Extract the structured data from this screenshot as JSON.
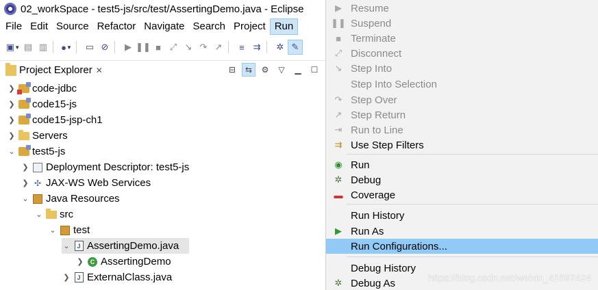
{
  "window": {
    "title": "02_workSpace - test5-js/src/test/AssertingDemo.java - Eclipse"
  },
  "menubar": {
    "items": [
      "File",
      "Edit",
      "Source",
      "Refactor",
      "Navigate",
      "Search",
      "Project",
      "Run"
    ],
    "active": "Run"
  },
  "view": {
    "title": "Project Explorer",
    "close_glyph": "✕"
  },
  "tree": [
    {
      "label": "code-jdbc",
      "level": 0,
      "expanded": false,
      "icon": "project-error-icon"
    },
    {
      "label": "code15-js",
      "level": 0,
      "expanded": false,
      "icon": "project-icon"
    },
    {
      "label": "code15-jsp-ch1",
      "level": 0,
      "expanded": false,
      "icon": "project-icon"
    },
    {
      "label": "Servers",
      "level": 0,
      "expanded": false,
      "icon": "folder-icon"
    },
    {
      "label": "test5-js",
      "level": 0,
      "expanded": true,
      "icon": "project-icon"
    },
    {
      "label": "Deployment Descriptor: test5-js",
      "level": 1,
      "expanded": false,
      "icon": "descriptor-icon"
    },
    {
      "label": "JAX-WS Web Services",
      "level": 1,
      "expanded": false,
      "icon": "webservice-icon"
    },
    {
      "label": "Java Resources",
      "level": 1,
      "expanded": true,
      "icon": "java-resources-icon"
    },
    {
      "label": "src",
      "level": 2,
      "expanded": true,
      "icon": "source-folder-icon"
    },
    {
      "label": "test",
      "level": 3,
      "expanded": true,
      "icon": "package-icon"
    },
    {
      "label": "AssertingDemo.java",
      "level": 4,
      "expanded": true,
      "icon": "java-file-icon",
      "selected": true
    },
    {
      "label": "AssertingDemo",
      "level": 5,
      "expanded": false,
      "icon": "class-icon"
    },
    {
      "label": "ExternalClass.java",
      "level": 4,
      "expanded": false,
      "icon": "java-file-icon"
    }
  ],
  "run_menu": {
    "items": [
      {
        "label": "Resume",
        "enabled": false,
        "icon": "resume-icon"
      },
      {
        "label": "Suspend",
        "enabled": false,
        "icon": "suspend-icon"
      },
      {
        "label": "Terminate",
        "enabled": false,
        "icon": "terminate-icon"
      },
      {
        "label": "Disconnect",
        "enabled": false,
        "icon": "disconnect-icon"
      },
      {
        "label": "Step Into",
        "enabled": false,
        "icon": "step-into-icon"
      },
      {
        "label": "Step Into Selection",
        "enabled": false,
        "icon": ""
      },
      {
        "label": "Step Over",
        "enabled": false,
        "icon": "step-over-icon"
      },
      {
        "label": "Step Return",
        "enabled": false,
        "icon": "step-return-icon"
      },
      {
        "label": "Run to Line",
        "enabled": false,
        "icon": "run-to-line-icon"
      },
      {
        "label": "Use Step Filters",
        "enabled": true,
        "icon": "step-filters-icon"
      },
      {
        "label": "Run",
        "enabled": true,
        "icon": "run-icon"
      },
      {
        "label": "Debug",
        "enabled": true,
        "icon": "debug-icon"
      },
      {
        "label": "Coverage",
        "enabled": true,
        "icon": "coverage-icon"
      },
      {
        "label": "Run History",
        "enabled": true,
        "icon": ""
      },
      {
        "label": "Run As",
        "enabled": true,
        "icon": "run-as-icon"
      },
      {
        "label": "Run Configurations...",
        "enabled": true,
        "icon": "",
        "hover": true
      },
      {
        "label": "Debug History",
        "enabled": true,
        "icon": ""
      },
      {
        "label": "Debug As",
        "enabled": true,
        "icon": "debug-as-icon"
      }
    ]
  },
  "watermark": "https://blog.csdn.net/weixin_41697424",
  "colors": {
    "menu_bg": "#f2f2f2",
    "hover": "#91c9f7",
    "active_menu": "#cce4f7",
    "selection": "#e5e5e5"
  }
}
